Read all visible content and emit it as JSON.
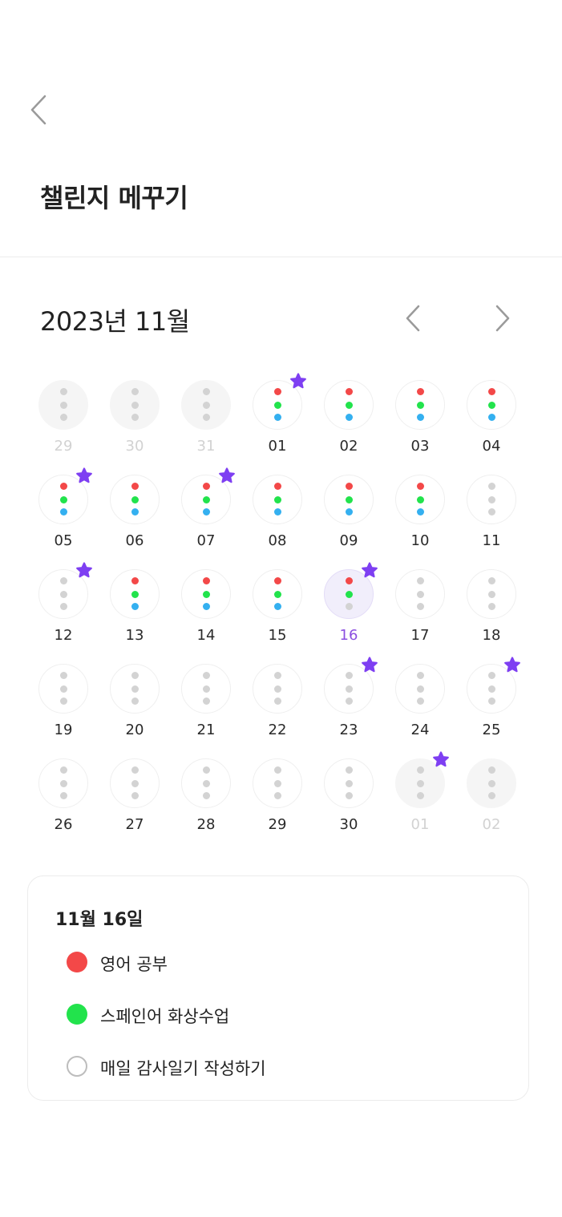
{
  "header": {
    "title": "챌린지 메꾸기"
  },
  "calendar": {
    "month_label": "2023년 11월",
    "colors": {
      "red": "#f34848",
      "green": "#22e34c",
      "blue": "#34b0f0",
      "gray": "#d3d3d3",
      "star": "#7e3ff2",
      "selected_text": "#8b4fe0"
    },
    "days": [
      {
        "label": "29",
        "in_month": false,
        "dots": [
          "gray",
          "gray",
          "gray"
        ],
        "star": false
      },
      {
        "label": "30",
        "in_month": false,
        "dots": [
          "gray",
          "gray",
          "gray"
        ],
        "star": false
      },
      {
        "label": "31",
        "in_month": false,
        "dots": [
          "gray",
          "gray",
          "gray"
        ],
        "star": false
      },
      {
        "label": "01",
        "in_month": true,
        "dots": [
          "red",
          "green",
          "blue"
        ],
        "star": true
      },
      {
        "label": "02",
        "in_month": true,
        "dots": [
          "red",
          "green",
          "blue"
        ],
        "star": false
      },
      {
        "label": "03",
        "in_month": true,
        "dots": [
          "red",
          "green",
          "blue"
        ],
        "star": false
      },
      {
        "label": "04",
        "in_month": true,
        "dots": [
          "red",
          "green",
          "blue"
        ],
        "star": false
      },
      {
        "label": "05",
        "in_month": true,
        "dots": [
          "red",
          "green",
          "blue"
        ],
        "star": true
      },
      {
        "label": "06",
        "in_month": true,
        "dots": [
          "red",
          "green",
          "blue"
        ],
        "star": false
      },
      {
        "label": "07",
        "in_month": true,
        "dots": [
          "red",
          "green",
          "blue"
        ],
        "star": true
      },
      {
        "label": "08",
        "in_month": true,
        "dots": [
          "red",
          "green",
          "blue"
        ],
        "star": false
      },
      {
        "label": "09",
        "in_month": true,
        "dots": [
          "red",
          "green",
          "blue"
        ],
        "star": false
      },
      {
        "label": "10",
        "in_month": true,
        "dots": [
          "red",
          "green",
          "blue"
        ],
        "star": false
      },
      {
        "label": "11",
        "in_month": true,
        "dots": [
          "gray",
          "gray",
          "gray"
        ],
        "star": false
      },
      {
        "label": "12",
        "in_month": true,
        "dots": [
          "gray",
          "gray",
          "gray"
        ],
        "star": true
      },
      {
        "label": "13",
        "in_month": true,
        "dots": [
          "red",
          "green",
          "blue"
        ],
        "star": false
      },
      {
        "label": "14",
        "in_month": true,
        "dots": [
          "red",
          "green",
          "blue"
        ],
        "star": false
      },
      {
        "label": "15",
        "in_month": true,
        "dots": [
          "red",
          "green",
          "blue"
        ],
        "star": false
      },
      {
        "label": "16",
        "in_month": true,
        "dots": [
          "red",
          "green",
          "gray"
        ],
        "star": true,
        "selected": true
      },
      {
        "label": "17",
        "in_month": true,
        "dots": [
          "gray",
          "gray",
          "gray"
        ],
        "star": false
      },
      {
        "label": "18",
        "in_month": true,
        "dots": [
          "gray",
          "gray",
          "gray"
        ],
        "star": false
      },
      {
        "label": "19",
        "in_month": true,
        "dots": [
          "gray",
          "gray",
          "gray"
        ],
        "star": false
      },
      {
        "label": "20",
        "in_month": true,
        "dots": [
          "gray",
          "gray",
          "gray"
        ],
        "star": false
      },
      {
        "label": "21",
        "in_month": true,
        "dots": [
          "gray",
          "gray",
          "gray"
        ],
        "star": false
      },
      {
        "label": "22",
        "in_month": true,
        "dots": [
          "gray",
          "gray",
          "gray"
        ],
        "star": false
      },
      {
        "label": "23",
        "in_month": true,
        "dots": [
          "gray",
          "gray",
          "gray"
        ],
        "star": true
      },
      {
        "label": "24",
        "in_month": true,
        "dots": [
          "gray",
          "gray",
          "gray"
        ],
        "star": false
      },
      {
        "label": "25",
        "in_month": true,
        "dots": [
          "gray",
          "gray",
          "gray"
        ],
        "star": true
      },
      {
        "label": "26",
        "in_month": true,
        "dots": [
          "gray",
          "gray",
          "gray"
        ],
        "star": false
      },
      {
        "label": "27",
        "in_month": true,
        "dots": [
          "gray",
          "gray",
          "gray"
        ],
        "star": false
      },
      {
        "label": "28",
        "in_month": true,
        "dots": [
          "gray",
          "gray",
          "gray"
        ],
        "star": false
      },
      {
        "label": "29",
        "in_month": true,
        "dots": [
          "gray",
          "gray",
          "gray"
        ],
        "star": false
      },
      {
        "label": "30",
        "in_month": true,
        "dots": [
          "gray",
          "gray",
          "gray"
        ],
        "star": false
      },
      {
        "label": "01",
        "in_month": false,
        "dots": [
          "gray",
          "gray",
          "gray"
        ],
        "star": true
      },
      {
        "label": "02",
        "in_month": false,
        "dots": [
          "gray",
          "gray",
          "gray"
        ],
        "star": false
      }
    ]
  },
  "detail": {
    "date_label": "11월 16일",
    "goals": [
      {
        "label": "영어 공부",
        "status": "done",
        "color": "#f34848"
      },
      {
        "label": "스페인어 화상수업",
        "status": "done",
        "color": "#22e34c"
      },
      {
        "label": "매일 감사일기 작성하기",
        "status": "pending",
        "color": "#bdbdbd"
      }
    ]
  }
}
